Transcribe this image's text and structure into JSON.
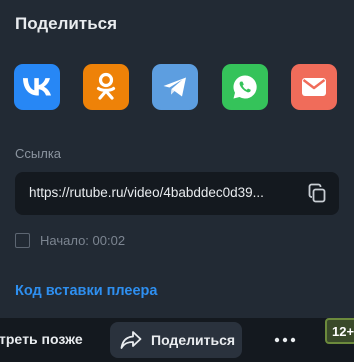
{
  "share": {
    "title": "Поделиться",
    "socials": [
      {
        "name": "vk",
        "icon": "vk-icon",
        "color": "#2787f5"
      },
      {
        "name": "odnoklassniki",
        "icon": "odnoklassniki-icon",
        "color": "#ee8208"
      },
      {
        "name": "telegram",
        "icon": "telegram-icon",
        "color": "#5d9ee0"
      },
      {
        "name": "whatsapp",
        "icon": "whatsapp-icon",
        "color": "#35c35a"
      },
      {
        "name": "email",
        "icon": "mail-icon",
        "color": "#f06c5a"
      }
    ],
    "link_label": "Ссылка",
    "link_value": "https://rutube.ru/video/4babddec0d39...",
    "start_label": "Начало: 00:02",
    "start_checked": false,
    "embed_label": "Код вставки плеера"
  },
  "bottom_bar": {
    "watch_later": "трeть позже",
    "share_label": "Поделиться",
    "more_label": "•••",
    "age_badge": "12+"
  }
}
